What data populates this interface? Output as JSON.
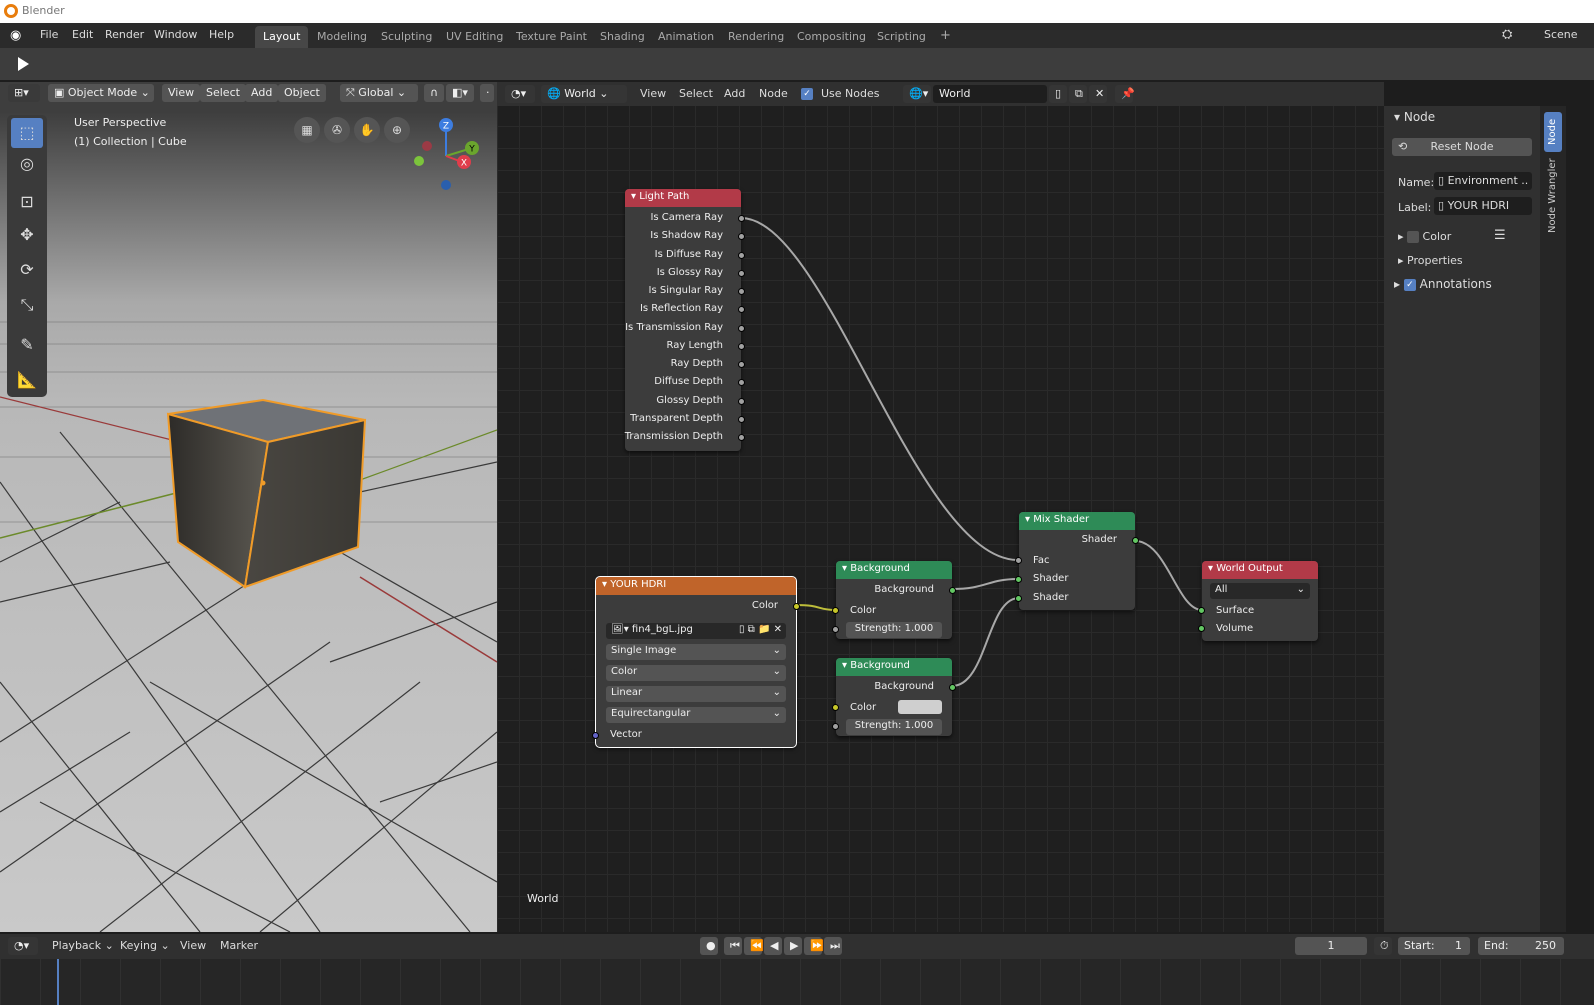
{
  "window": {
    "title": "Blender"
  },
  "menu": {
    "items": [
      "File",
      "Edit",
      "Render",
      "Window",
      "Help"
    ]
  },
  "workspaces": [
    "Layout",
    "Modeling",
    "Sculpting",
    "UV Editing",
    "Texture Paint",
    "Shading",
    "Animation",
    "Rendering",
    "Compositing",
    "Scripting",
    "+"
  ],
  "active_workspace": "Layout",
  "scene": {
    "label": "Scene"
  },
  "viewport": {
    "mode": "Object Mode",
    "menus": [
      "View",
      "Select",
      "Add",
      "Object"
    ],
    "orientation": "Global",
    "overlay_title": "User Perspective",
    "overlay_collection": "(1) Collection | Cube",
    "gizmo_axes": {
      "x": "X",
      "y": "Y",
      "z": "Z"
    }
  },
  "node_editor": {
    "world_selector": "World",
    "menus": [
      "View",
      "Select",
      "Add",
      "Node"
    ],
    "use_nodes_label": "Use Nodes",
    "world_name": "World",
    "footer_label": "World",
    "nodes": {
      "light_path": {
        "title": "Light Path",
        "outputs": [
          "Is Camera Ray",
          "Is Shadow Ray",
          "Is Diffuse Ray",
          "Is Glossy Ray",
          "Is Singular Ray",
          "Is Reflection Ray",
          "Is Transmission Ray",
          "Ray Length",
          "Ray Depth",
          "Diffuse Depth",
          "Glossy Depth",
          "Transparent Depth",
          "Transmission Depth"
        ]
      },
      "hdri": {
        "title": "YOUR HDRI",
        "output": "Color",
        "image": "fin4_bgL.jpg",
        "source": "Single Image",
        "color_space": "Color",
        "interpolation": "Linear",
        "projection": "Equirectangular",
        "input": "Vector"
      },
      "background1": {
        "title": "Background",
        "output": "Background",
        "color_label": "Color",
        "strength": "Strength: 1.000"
      },
      "background2": {
        "title": "Background",
        "output": "Background",
        "color_label": "Color",
        "strength": "Strength: 1.000"
      },
      "mix_shader": {
        "title": "Mix Shader",
        "output": "Shader",
        "inputs": [
          "Fac",
          "Shader",
          "Shader"
        ]
      },
      "world_output": {
        "title": "World Output",
        "target": "All",
        "inputs": [
          "Surface",
          "Volume"
        ]
      }
    }
  },
  "sidebar": {
    "panel_title": "Node",
    "reset_button": "Reset Node",
    "name_label": "Name:",
    "name_value": "Environment ..",
    "label_label": "Label:",
    "label_value": "YOUR HDRI",
    "color_label": "Color",
    "properties_label": "Properties",
    "annotations_label": "Annotations",
    "tabs": [
      "Node",
      "Node Wrangler"
    ]
  },
  "timeline": {
    "menus": [
      "Playback",
      "Keying",
      "View",
      "Marker"
    ],
    "current_frame": "1",
    "start_label": "Start:",
    "start_value": "1",
    "end_label": "End:",
    "end_value": "250"
  },
  "colors": {
    "light_path_header": "#b23a48",
    "texture_header": "#c0642a",
    "shader_header": "#2e8b57",
    "output_header": "#b23a48",
    "accent": "#5680c2",
    "selection": "#f09b28"
  }
}
